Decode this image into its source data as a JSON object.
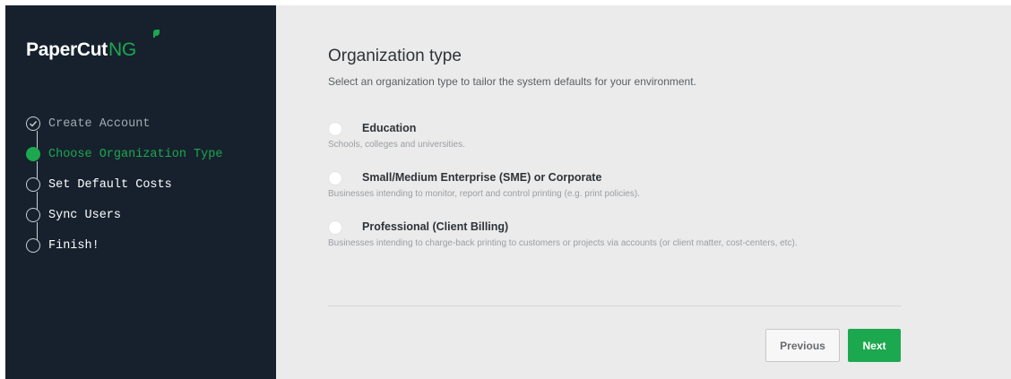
{
  "brand": {
    "name_main": "PaperCut",
    "name_suffix": "NG",
    "accent_color": "#1ca84f",
    "sidebar_color": "#16212d"
  },
  "steps": [
    {
      "label": "Create Account",
      "state": "done",
      "icon": "check-circle-icon"
    },
    {
      "label": "Choose Organization Type",
      "state": "active",
      "icon": "filled-circle-icon"
    },
    {
      "label": "Set Default Costs",
      "state": "pending",
      "icon": "empty-circle-icon"
    },
    {
      "label": "Sync Users",
      "state": "pending",
      "icon": "empty-circle-icon"
    },
    {
      "label": "Finish!",
      "state": "pending",
      "icon": "empty-circle-icon"
    }
  ],
  "main": {
    "title": "Organization type",
    "subtitle": "Select an organization type to tailor the system defaults for your environment.",
    "options": [
      {
        "label": "Education",
        "description": "Schools, colleges and universities.",
        "selected": false
      },
      {
        "label": "Small/Medium Enterprise (SME) or Corporate",
        "description": "Businesses intending to monitor, report and control printing (e.g. print policies).",
        "selected": false
      },
      {
        "label": "Professional (Client Billing)",
        "description": "Businesses intending to charge-back printing to customers or projects via accounts (or client matter, cost-centers, etc).",
        "selected": false
      }
    ]
  },
  "buttons": {
    "previous": "Previous",
    "next": "Next"
  }
}
